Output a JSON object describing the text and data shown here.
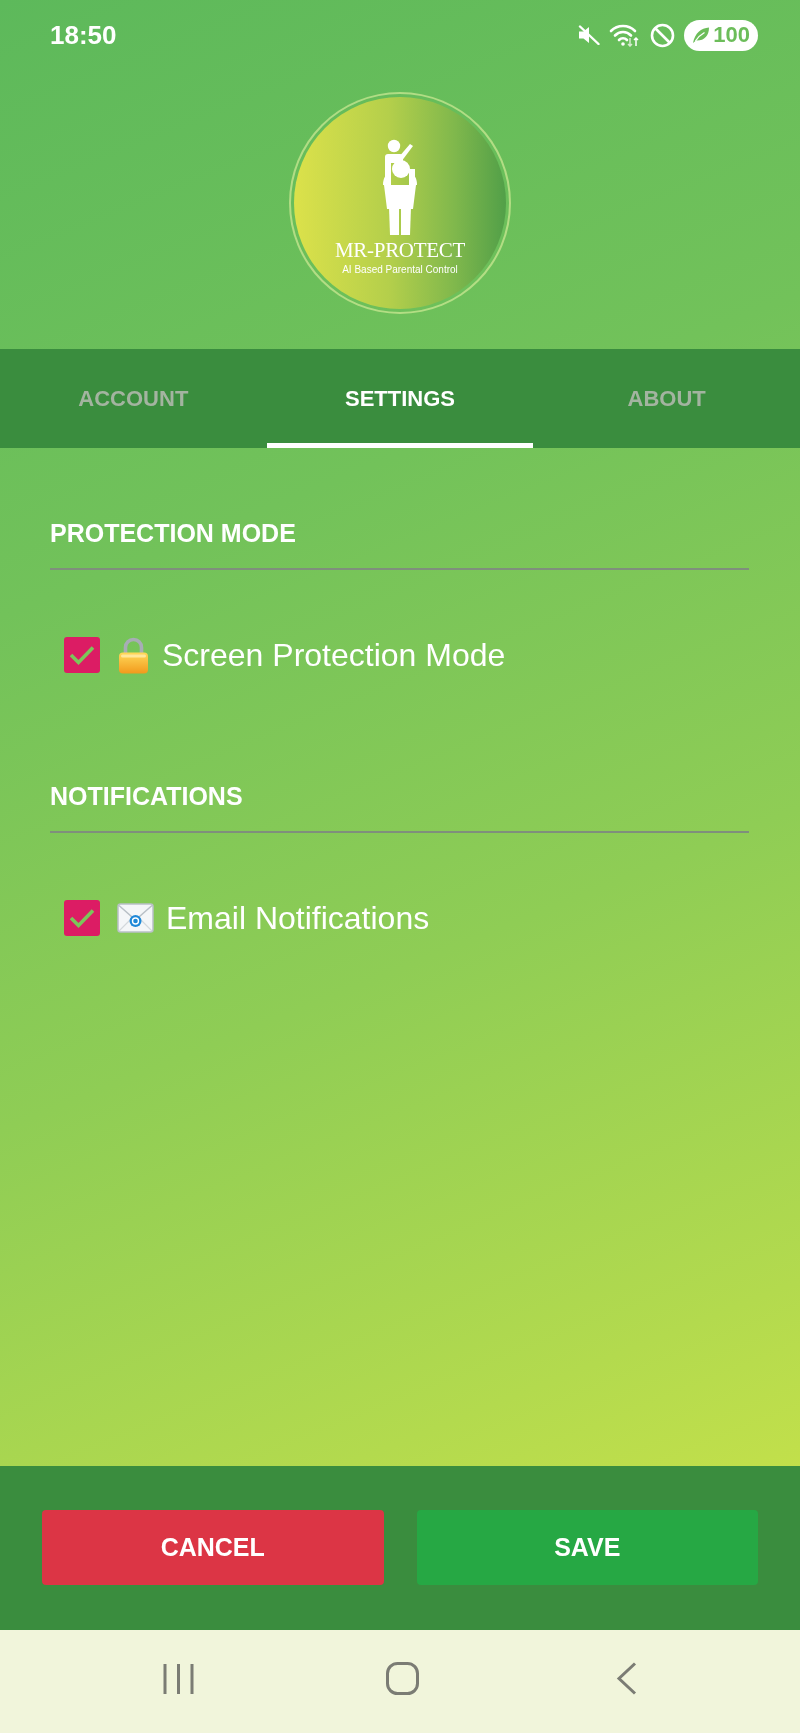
{
  "status_bar": {
    "time": "18:50",
    "battery": "100"
  },
  "logo": {
    "title": "MR-PROTECT",
    "tagline": "AI Based Parental Control"
  },
  "tabs": [
    {
      "label": "ACCOUNT",
      "selected": false
    },
    {
      "label": "SETTINGS",
      "selected": true
    },
    {
      "label": "ABOUT",
      "selected": false
    }
  ],
  "sections": [
    {
      "title": "PROTECTION MODE",
      "options": [
        {
          "label": "Screen Protection Mode",
          "checked": true
        }
      ]
    },
    {
      "title": "NOTIFICATIONS",
      "options": [
        {
          "label": "Email Notifications",
          "checked": true
        }
      ]
    }
  ],
  "buttons": [
    {
      "label": "CANCEL",
      "kind": "cancel"
    },
    {
      "label": "SAVE",
      "kind": "save"
    }
  ]
}
